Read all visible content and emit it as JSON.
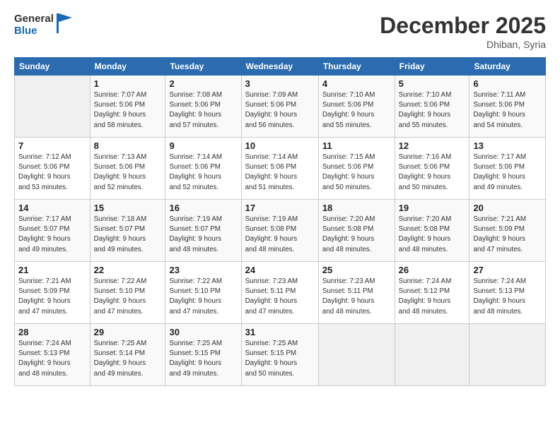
{
  "header": {
    "logo_line1": "General",
    "logo_line2": "Blue",
    "month": "December 2025",
    "location": "Dhiban, Syria"
  },
  "weekdays": [
    "Sunday",
    "Monday",
    "Tuesday",
    "Wednesday",
    "Thursday",
    "Friday",
    "Saturday"
  ],
  "weeks": [
    [
      {
        "day": "",
        "sunrise": "",
        "sunset": "",
        "daylight": ""
      },
      {
        "day": "1",
        "sunrise": "Sunrise: 7:07 AM",
        "sunset": "Sunset: 5:06 PM",
        "daylight": "Daylight: 9 hours and 58 minutes."
      },
      {
        "day": "2",
        "sunrise": "Sunrise: 7:08 AM",
        "sunset": "Sunset: 5:06 PM",
        "daylight": "Daylight: 9 hours and 57 minutes."
      },
      {
        "day": "3",
        "sunrise": "Sunrise: 7:09 AM",
        "sunset": "Sunset: 5:06 PM",
        "daylight": "Daylight: 9 hours and 56 minutes."
      },
      {
        "day": "4",
        "sunrise": "Sunrise: 7:10 AM",
        "sunset": "Sunset: 5:06 PM",
        "daylight": "Daylight: 9 hours and 55 minutes."
      },
      {
        "day": "5",
        "sunrise": "Sunrise: 7:10 AM",
        "sunset": "Sunset: 5:06 PM",
        "daylight": "Daylight: 9 hours and 55 minutes."
      },
      {
        "day": "6",
        "sunrise": "Sunrise: 7:11 AM",
        "sunset": "Sunset: 5:06 PM",
        "daylight": "Daylight: 9 hours and 54 minutes."
      }
    ],
    [
      {
        "day": "7",
        "sunrise": "Sunrise: 7:12 AM",
        "sunset": "Sunset: 5:06 PM",
        "daylight": "Daylight: 9 hours and 53 minutes."
      },
      {
        "day": "8",
        "sunrise": "Sunrise: 7:13 AM",
        "sunset": "Sunset: 5:06 PM",
        "daylight": "Daylight: 9 hours and 52 minutes."
      },
      {
        "day": "9",
        "sunrise": "Sunrise: 7:14 AM",
        "sunset": "Sunset: 5:06 PM",
        "daylight": "Daylight: 9 hours and 52 minutes."
      },
      {
        "day": "10",
        "sunrise": "Sunrise: 7:14 AM",
        "sunset": "Sunset: 5:06 PM",
        "daylight": "Daylight: 9 hours and 51 minutes."
      },
      {
        "day": "11",
        "sunrise": "Sunrise: 7:15 AM",
        "sunset": "Sunset: 5:06 PM",
        "daylight": "Daylight: 9 hours and 50 minutes."
      },
      {
        "day": "12",
        "sunrise": "Sunrise: 7:16 AM",
        "sunset": "Sunset: 5:06 PM",
        "daylight": "Daylight: 9 hours and 50 minutes."
      },
      {
        "day": "13",
        "sunrise": "Sunrise: 7:17 AM",
        "sunset": "Sunset: 5:06 PM",
        "daylight": "Daylight: 9 hours and 49 minutes."
      }
    ],
    [
      {
        "day": "14",
        "sunrise": "Sunrise: 7:17 AM",
        "sunset": "Sunset: 5:07 PM",
        "daylight": "Daylight: 9 hours and 49 minutes."
      },
      {
        "day": "15",
        "sunrise": "Sunrise: 7:18 AM",
        "sunset": "Sunset: 5:07 PM",
        "daylight": "Daylight: 9 hours and 49 minutes."
      },
      {
        "day": "16",
        "sunrise": "Sunrise: 7:19 AM",
        "sunset": "Sunset: 5:07 PM",
        "daylight": "Daylight: 9 hours and 48 minutes."
      },
      {
        "day": "17",
        "sunrise": "Sunrise: 7:19 AM",
        "sunset": "Sunset: 5:08 PM",
        "daylight": "Daylight: 9 hours and 48 minutes."
      },
      {
        "day": "18",
        "sunrise": "Sunrise: 7:20 AM",
        "sunset": "Sunset: 5:08 PM",
        "daylight": "Daylight: 9 hours and 48 minutes."
      },
      {
        "day": "19",
        "sunrise": "Sunrise: 7:20 AM",
        "sunset": "Sunset: 5:08 PM",
        "daylight": "Daylight: 9 hours and 48 minutes."
      },
      {
        "day": "20",
        "sunrise": "Sunrise: 7:21 AM",
        "sunset": "Sunset: 5:09 PM",
        "daylight": "Daylight: 9 hours and 47 minutes."
      }
    ],
    [
      {
        "day": "21",
        "sunrise": "Sunrise: 7:21 AM",
        "sunset": "Sunset: 5:09 PM",
        "daylight": "Daylight: 9 hours and 47 minutes."
      },
      {
        "day": "22",
        "sunrise": "Sunrise: 7:22 AM",
        "sunset": "Sunset: 5:10 PM",
        "daylight": "Daylight: 9 hours and 47 minutes."
      },
      {
        "day": "23",
        "sunrise": "Sunrise: 7:22 AM",
        "sunset": "Sunset: 5:10 PM",
        "daylight": "Daylight: 9 hours and 47 minutes."
      },
      {
        "day": "24",
        "sunrise": "Sunrise: 7:23 AM",
        "sunset": "Sunset: 5:11 PM",
        "daylight": "Daylight: 9 hours and 47 minutes."
      },
      {
        "day": "25",
        "sunrise": "Sunrise: 7:23 AM",
        "sunset": "Sunset: 5:11 PM",
        "daylight": "Daylight: 9 hours and 48 minutes."
      },
      {
        "day": "26",
        "sunrise": "Sunrise: 7:24 AM",
        "sunset": "Sunset: 5:12 PM",
        "daylight": "Daylight: 9 hours and 48 minutes."
      },
      {
        "day": "27",
        "sunrise": "Sunrise: 7:24 AM",
        "sunset": "Sunset: 5:13 PM",
        "daylight": "Daylight: 9 hours and 48 minutes."
      }
    ],
    [
      {
        "day": "28",
        "sunrise": "Sunrise: 7:24 AM",
        "sunset": "Sunset: 5:13 PM",
        "daylight": "Daylight: 9 hours and 48 minutes."
      },
      {
        "day": "29",
        "sunrise": "Sunrise: 7:25 AM",
        "sunset": "Sunset: 5:14 PM",
        "daylight": "Daylight: 9 hours and 49 minutes."
      },
      {
        "day": "30",
        "sunrise": "Sunrise: 7:25 AM",
        "sunset": "Sunset: 5:15 PM",
        "daylight": "Daylight: 9 hours and 49 minutes."
      },
      {
        "day": "31",
        "sunrise": "Sunrise: 7:25 AM",
        "sunset": "Sunset: 5:15 PM",
        "daylight": "Daylight: 9 hours and 50 minutes."
      },
      {
        "day": "",
        "sunrise": "",
        "sunset": "",
        "daylight": ""
      },
      {
        "day": "",
        "sunrise": "",
        "sunset": "",
        "daylight": ""
      },
      {
        "day": "",
        "sunrise": "",
        "sunset": "",
        "daylight": ""
      }
    ]
  ]
}
